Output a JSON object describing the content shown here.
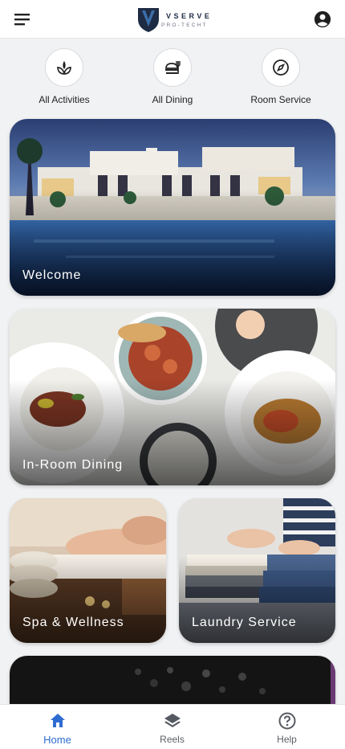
{
  "header": {
    "logo_main": "VSERVE",
    "logo_sub": "PRO-TECHT"
  },
  "quick_actions": [
    {
      "label": "All Activities",
      "icon": "sprout-icon"
    },
    {
      "label": "All Dining",
      "icon": "dining-icon"
    },
    {
      "label": "Room Service",
      "icon": "compass-icon"
    }
  ],
  "cards": [
    {
      "title": "Welcome"
    },
    {
      "title": "In-Room Dining"
    },
    {
      "title": "Spa & Wellness"
    },
    {
      "title": "Laundry Service"
    },
    {
      "title": ""
    }
  ],
  "bottom_nav": [
    {
      "label": "Home",
      "icon": "home-icon",
      "active": true
    },
    {
      "label": "Reels",
      "icon": "layers-icon",
      "active": false
    },
    {
      "label": "Help",
      "icon": "help-icon",
      "active": false
    }
  ],
  "colors": {
    "accent": "#2e6cd1",
    "background": "#f1f2f4",
    "logo_navy": "#1e2b44"
  }
}
